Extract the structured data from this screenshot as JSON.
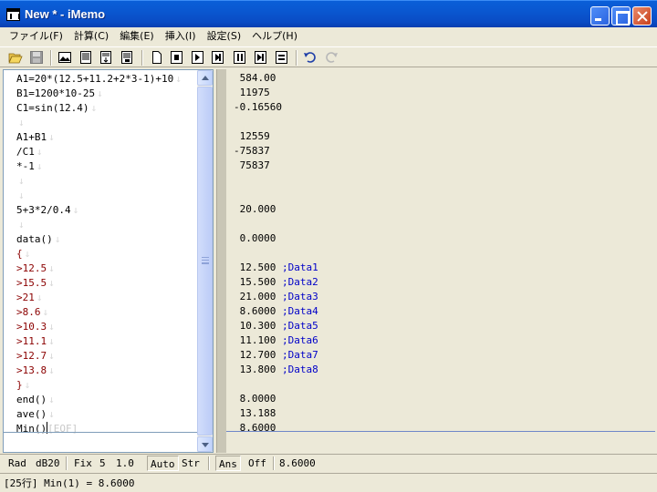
{
  "window": {
    "title": "New * - iMemo"
  },
  "menu": [
    {
      "label": "ファイル(F)"
    },
    {
      "label": "計算(C)"
    },
    {
      "label": "編集(E)"
    },
    {
      "label": "挿入(I)"
    },
    {
      "label": "設定(S)"
    },
    {
      "label": "ヘルプ(H)"
    }
  ],
  "toolbar": {
    "icons": [
      "open-folder-icon",
      "save-icon",
      "image-icon",
      "list-icon",
      "insert-icon",
      "export-icon",
      "new-page-icon",
      "stop-icon",
      "play-icon",
      "step-icon",
      "pause-icon",
      "next-icon",
      "lines-icon",
      "undo-icon",
      "redo-icon"
    ]
  },
  "editor": {
    "lines": [
      {
        "text": "A1=20*(12.5+11.2+2*3-1)+10",
        "color": "#000000"
      },
      {
        "text": "B1=1200*10-25",
        "color": "#000000"
      },
      {
        "text": "C1=sin(12.4)",
        "color": "#000000"
      },
      {
        "text": "",
        "color": "#000000"
      },
      {
        "text": "A1+B1",
        "color": "#000000"
      },
      {
        "text": "/C1",
        "color": "#000000"
      },
      {
        "text": "*-1",
        "color": "#000000"
      },
      {
        "text": "",
        "color": "#000000"
      },
      {
        "text": "",
        "color": "#000000"
      },
      {
        "text": "5+3*2/0.4",
        "color": "#000000"
      },
      {
        "text": "",
        "color": "#000000"
      },
      {
        "text": "data()",
        "color": "#000000"
      },
      {
        "text": "{",
        "color": "#8b0000"
      },
      {
        "text": ">12.5",
        "color": "#8b0000"
      },
      {
        "text": ">15.5",
        "color": "#8b0000"
      },
      {
        "text": ">21",
        "color": "#8b0000"
      },
      {
        "text": ">8.6",
        "color": "#8b0000"
      },
      {
        "text": ">10.3",
        "color": "#8b0000"
      },
      {
        "text": ">11.1",
        "color": "#8b0000"
      },
      {
        "text": ">12.7",
        "color": "#8b0000"
      },
      {
        "text": ">13.8",
        "color": "#8b0000"
      },
      {
        "text": "}",
        "color": "#8b0000"
      },
      {
        "text": "end()",
        "color": "#000000"
      },
      {
        "text": "ave()",
        "color": "#000000"
      },
      {
        "text": "Min()",
        "color": "#000000"
      }
    ],
    "eof_marker": "[EOF]",
    "line_end_mark": "↓"
  },
  "results": {
    "lines": [
      {
        "value": " 584.00",
        "comment": ""
      },
      {
        "value": " 11975",
        "comment": ""
      },
      {
        "value": "-0.16560",
        "comment": ""
      },
      {
        "value": "",
        "comment": ""
      },
      {
        "value": " 12559",
        "comment": ""
      },
      {
        "value": "-75837",
        "comment": ""
      },
      {
        "value": " 75837",
        "comment": ""
      },
      {
        "value": "",
        "comment": ""
      },
      {
        "value": "",
        "comment": ""
      },
      {
        "value": " 20.000",
        "comment": ""
      },
      {
        "value": "",
        "comment": ""
      },
      {
        "value": " 0.0000",
        "comment": ""
      },
      {
        "value": "",
        "comment": ""
      },
      {
        "value": " 12.500 ",
        "comment": ";Data1"
      },
      {
        "value": " 15.500 ",
        "comment": ";Data2"
      },
      {
        "value": " 21.000 ",
        "comment": ";Data3"
      },
      {
        "value": " 8.6000 ",
        "comment": ";Data4"
      },
      {
        "value": " 10.300 ",
        "comment": ";Data5"
      },
      {
        "value": " 11.100 ",
        "comment": ";Data6"
      },
      {
        "value": " 12.700 ",
        "comment": ";Data7"
      },
      {
        "value": " 13.800 ",
        "comment": ";Data8"
      },
      {
        "value": "",
        "comment": ""
      },
      {
        "value": " 8.0000",
        "comment": ""
      },
      {
        "value": " 13.188",
        "comment": ""
      },
      {
        "value": " 8.6000",
        "comment": ""
      }
    ]
  },
  "status": {
    "angle": "Rad",
    "db": "dB20",
    "fix": "Fix",
    "fix_digits": "5",
    "fix_value": "1.0",
    "auto": "Auto",
    "str": "Str",
    "ans": "Ans",
    "off": "Off",
    "ans_value": "8.6000"
  },
  "info": {
    "text": "[25行] Min(1) = 8.6000"
  },
  "colors": {
    "title_bar": "#0a57d0",
    "comment_blue": "#0000c8",
    "data_red": "#8b0000"
  }
}
